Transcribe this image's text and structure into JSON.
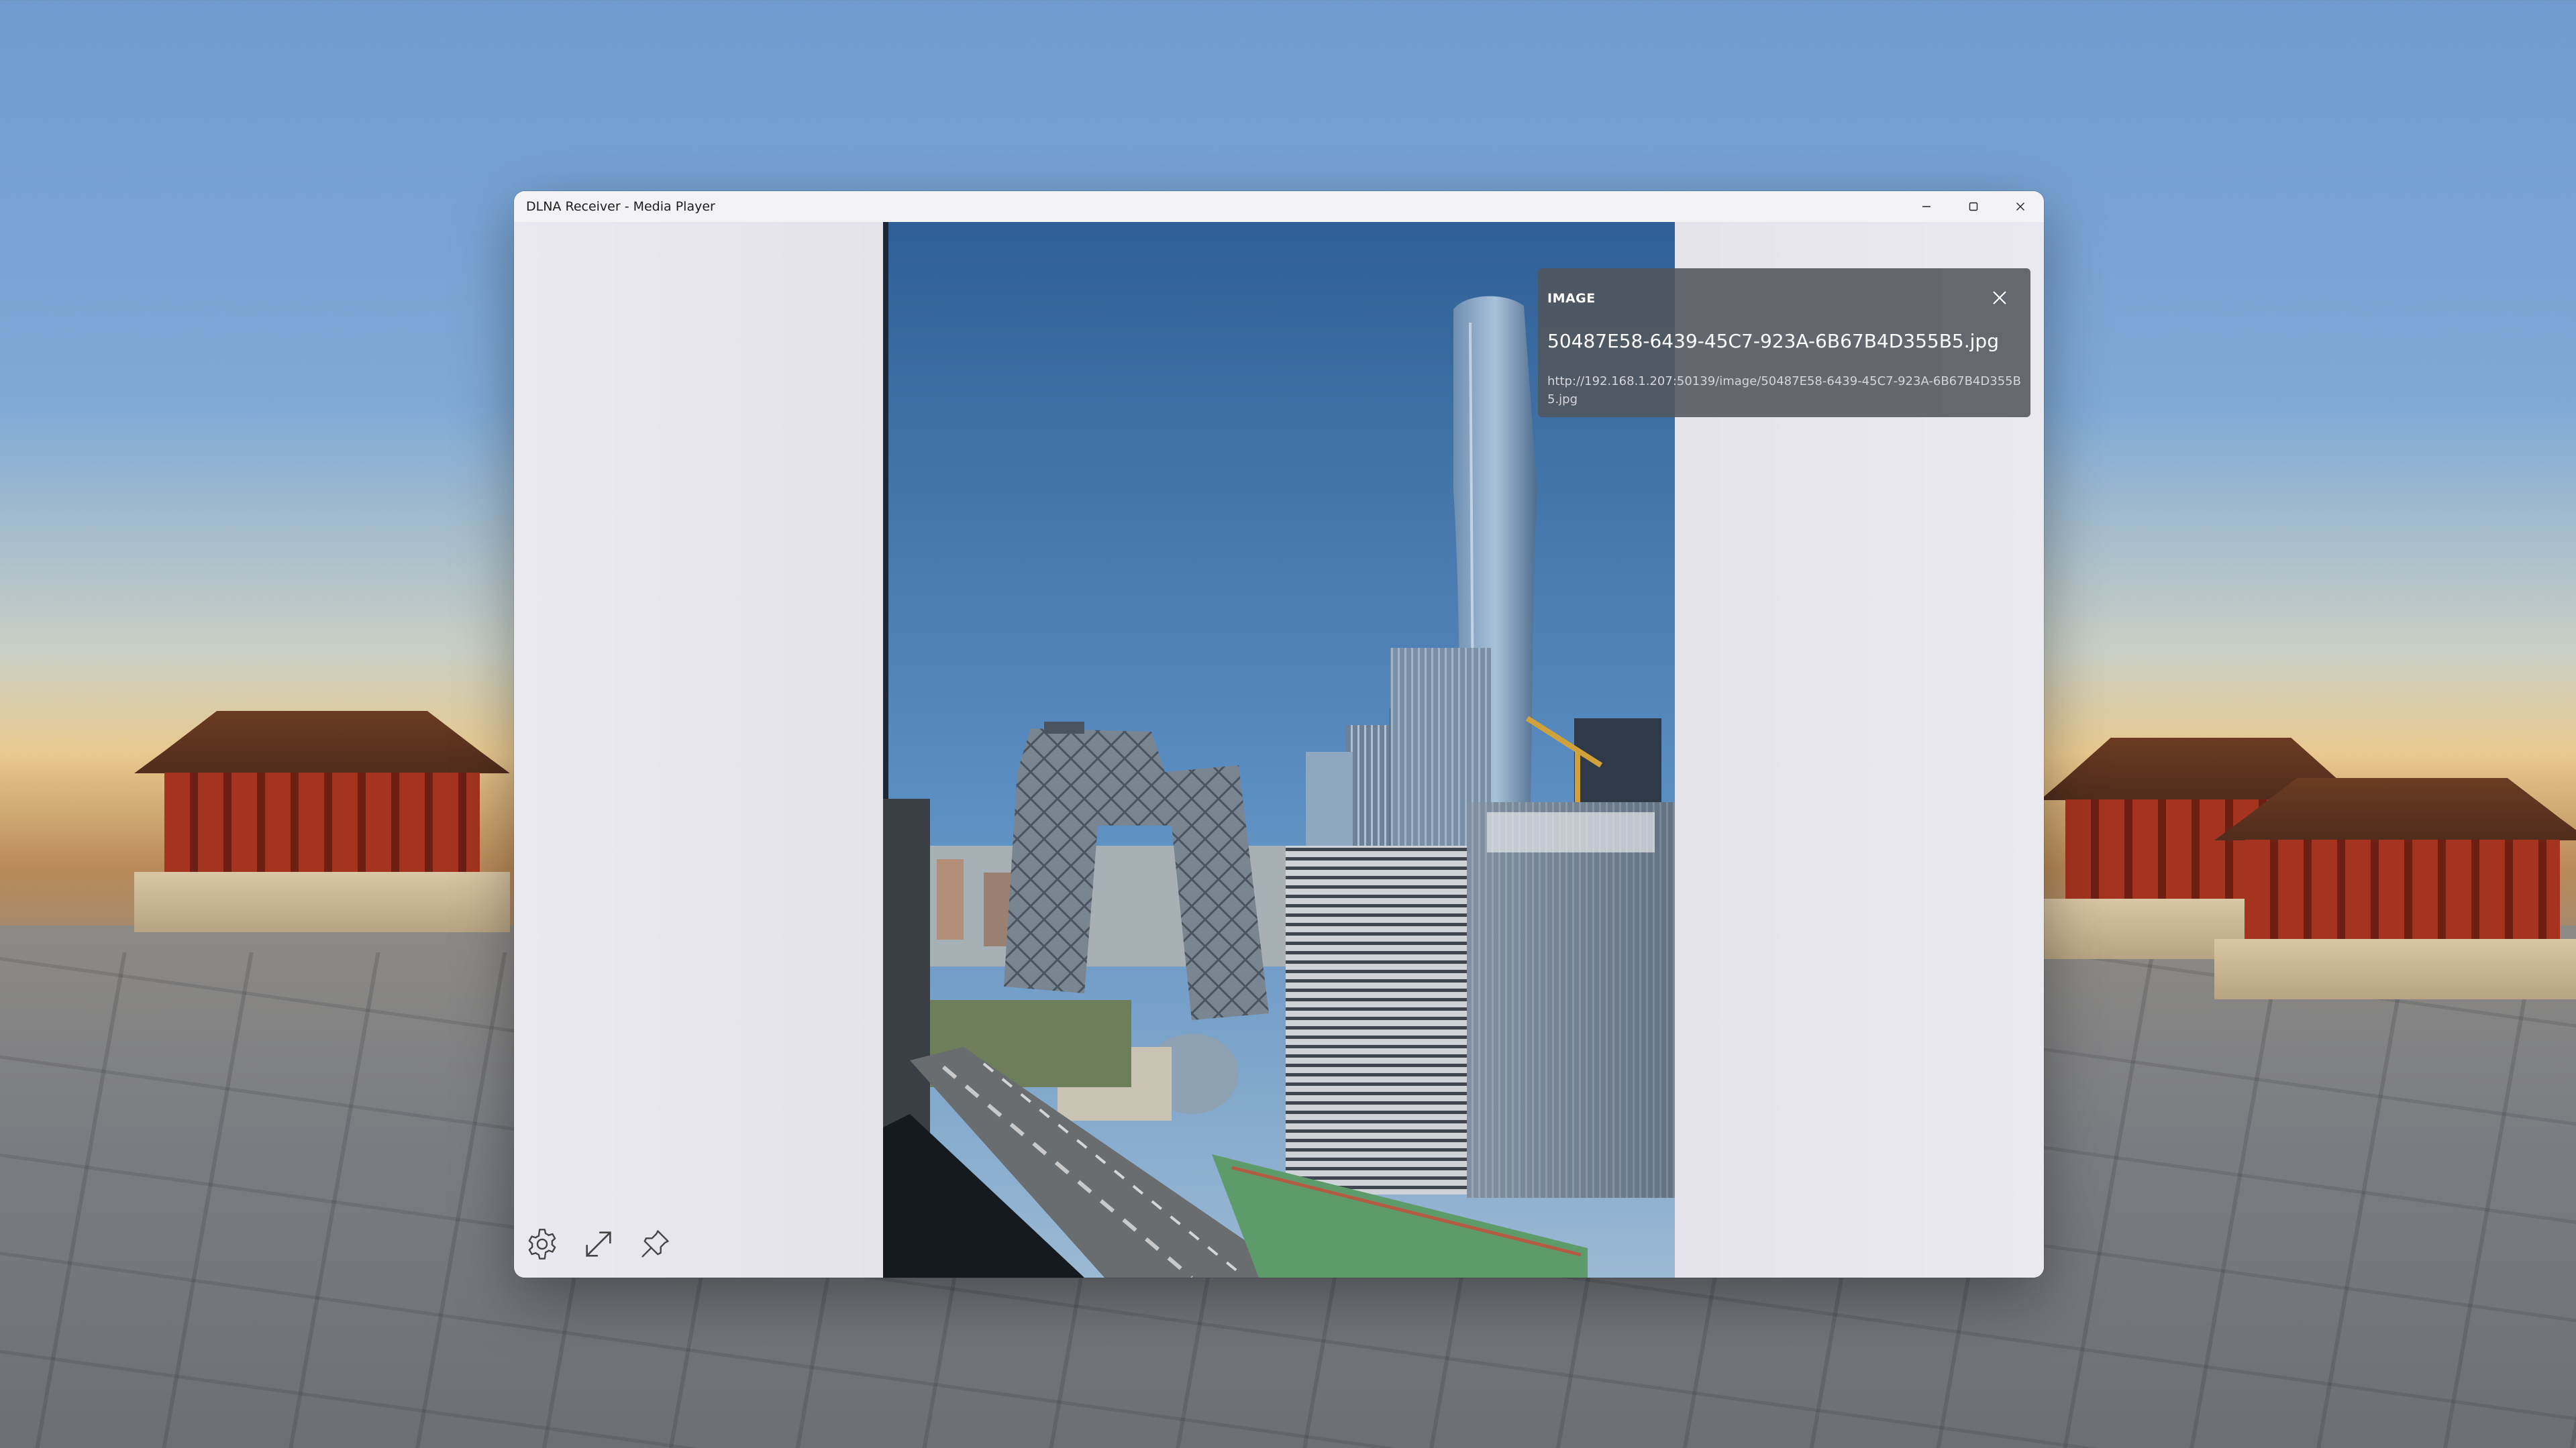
{
  "window": {
    "title": "DLNA Receiver - Media Player",
    "controls": {
      "minimize_icon": "minimize-icon",
      "maximize_icon": "maximize-icon",
      "close_icon": "close-icon"
    }
  },
  "info_panel": {
    "type_label": "IMAGE",
    "file_name": "50487E58-6439-45C7-923A-6B67B4D355B5.jpg",
    "url": "http://192.168.1.207:50139/image/50487E58-6439-45C7-923A-6B67B4D355B5.jpg",
    "close_icon": "close-icon"
  },
  "toolbar": {
    "items": [
      {
        "icon": "gear-icon"
      },
      {
        "icon": "fullscreen-icon"
      },
      {
        "icon": "pin-icon"
      }
    ]
  },
  "colors": {
    "window_background": "#ececf1",
    "info_panel_background": "#52565c",
    "icon_color": "#444444"
  }
}
